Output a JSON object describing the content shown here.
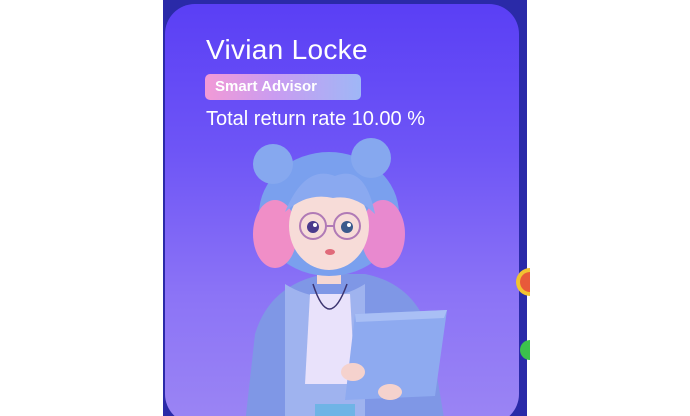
{
  "profile": {
    "name": "Vivian Locke",
    "badge": "Smart Advisor",
    "return_text": "Total return rate 10.00 %"
  },
  "colors": {
    "card_gradient_top": "#5a3ff5",
    "card_gradient_bottom": "#9b85f4",
    "frame": "#2a2aa8",
    "badge_start": "#f29ad6",
    "badge_end": "#9fb7f6"
  },
  "illustration": {
    "icon": "advisor-avatar-illustration"
  }
}
